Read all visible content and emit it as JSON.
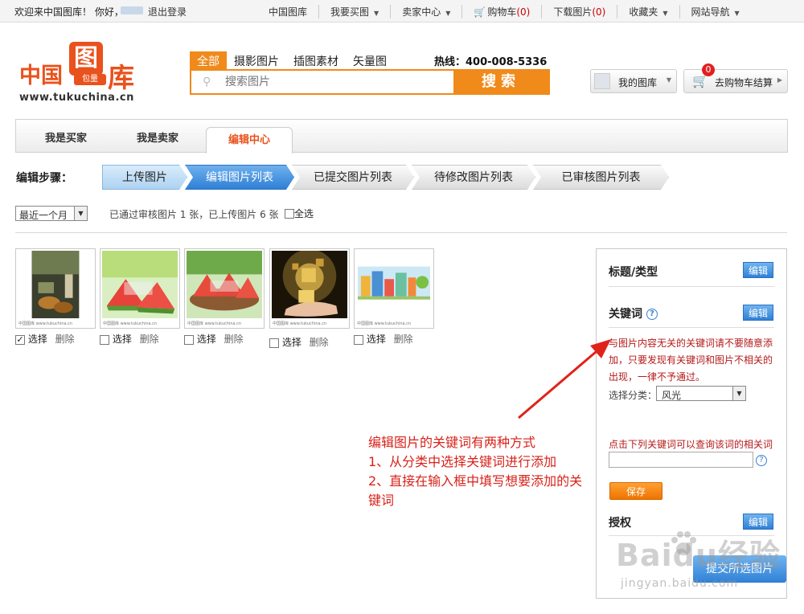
{
  "topbar": {
    "welcome": "欢迎来中国图库！ 你好，",
    "logout": "退出登录",
    "nav": [
      {
        "label": "中国图库",
        "dropdown": false
      },
      {
        "label": "我要买图",
        "dropdown": true
      },
      {
        "label": "卖家中心",
        "dropdown": true
      },
      {
        "label": "购物车",
        "count": "(0)",
        "dropdown": false
      },
      {
        "label": "下载图片",
        "count": "(0)",
        "dropdown": false
      },
      {
        "label": "收藏夹",
        "dropdown": true
      },
      {
        "label": "网站导航",
        "dropdown": true
      }
    ]
  },
  "logo": {
    "left": "中国",
    "mid": "图",
    "sub": "包量",
    "right": "库",
    "url": "www.tukuchina.cn"
  },
  "search": {
    "tabs": [
      "全部",
      "摄影图片",
      "插图素材",
      "矢量图"
    ],
    "active_tab": 0,
    "hotline": "热线：400-008-5336",
    "placeholder": "搜索图片",
    "button": "搜索"
  },
  "mylib": {
    "label": "我的图库"
  },
  "cart": {
    "count": "0",
    "label": "去购物车结算"
  },
  "role_tabs": [
    "我是买家",
    "我是卖家",
    "编辑中心"
  ],
  "steps": {
    "label": "编辑步骤：",
    "items": [
      "上传图片",
      "编辑图片列表",
      "已提交图片列表",
      "待修改图片列表",
      "已审核图片列表"
    ]
  },
  "filter": {
    "period": "最近一个月",
    "stats": "已通过审核图片 1 张，已上传图片 6 张",
    "select_all": "全选"
  },
  "thumbs": {
    "select_label": "选择",
    "delete_label": "删除",
    "caption": "中国图库 www.tukuchina.cn",
    "items": [
      {
        "checked": true,
        "subject": "mooncake-tea"
      },
      {
        "checked": false,
        "subject": "watermelon-slices"
      },
      {
        "checked": false,
        "subject": "watermelon-plate"
      },
      {
        "checked": false,
        "subject": "gift-hand"
      },
      {
        "checked": false,
        "subject": "city-illustration"
      }
    ]
  },
  "panel": {
    "title_type": "标题/类型",
    "edit": "编辑",
    "keywords": "关键词",
    "warning": "与图片内容无关的关键词请不要随意添加，只要发现有关键词和图片不相关的出现，一律不予通过。",
    "category_label": "选择分类：",
    "category_value": "风光",
    "hint": "点击下列关键词可以查询该词的相关词",
    "save": "保存",
    "license": "授权",
    "submit": "提交所选图片"
  },
  "annotation": {
    "lines": [
      "编辑图片的关键词有两种方式",
      "1、从分类中选择关键词进行添加",
      "2、直接在输入框中填写想要添加的关键词"
    ],
    "color": "#d8221a"
  },
  "watermark": {
    "main": "Baidu经验",
    "sub": "jingyan.baidu.com"
  },
  "colors": {
    "brand": "#e9521c",
    "accent": "#f08a1a",
    "blue": "#2f80d6"
  }
}
